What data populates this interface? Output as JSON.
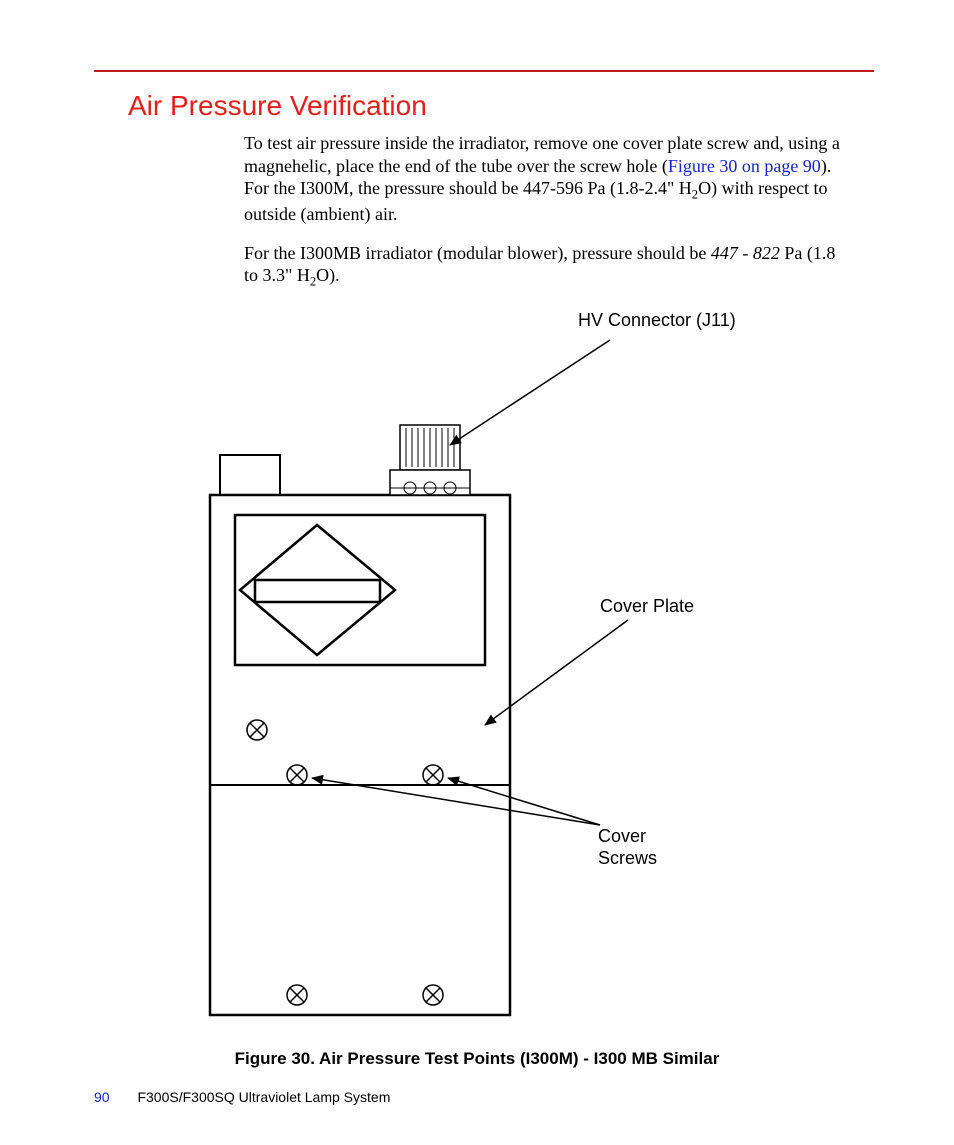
{
  "section_title": "Air Pressure Verification",
  "paragraphs": {
    "p1_a": "To test air pressure inside the irradiator, remove one cover plate screw and, using a magnehelic, place the end of the tube over the screw hole (",
    "p1_xref": "Figure 30 on page 90",
    "p1_b": "). For the I300M, the pressure should be 447-596 Pa (1.8-2.4\" H",
    "p1_sub": "2",
    "p1_c": "O) with respect to outside (ambient) air.",
    "p2_a": "For the I300MB irradiator (modular blower), pressure should be ",
    "p2_i": "447 - 822",
    "p2_b": " Pa (1.8 to 3.3\" H",
    "p2_sub": "2",
    "p2_c": "O)."
  },
  "labels": {
    "hv_connector": "HV Connector (J11)",
    "cover_plate": "Cover Plate",
    "cover_screws_l1": "Cover",
    "cover_screws_l2": "Screws"
  },
  "caption": "Figure 30. Air Pressure Test Points (I300M) - I300 MB Similar",
  "footer": {
    "page_number": "90",
    "doc_title": "F300S/F300SQ Ultraviolet Lamp System"
  }
}
